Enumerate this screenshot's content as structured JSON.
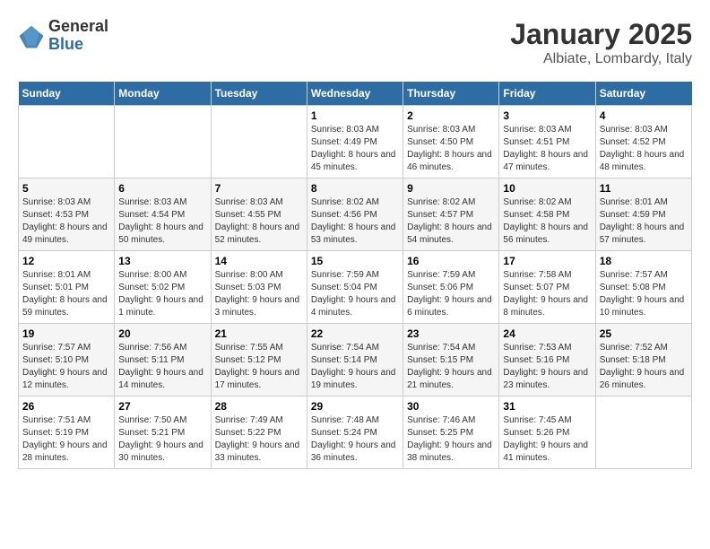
{
  "logo": {
    "general": "General",
    "blue": "Blue"
  },
  "title": "January 2025",
  "location": "Albiate, Lombardy, Italy",
  "weekdays": [
    "Sunday",
    "Monday",
    "Tuesday",
    "Wednesday",
    "Thursday",
    "Friday",
    "Saturday"
  ],
  "weeks": [
    [
      {
        "day": "",
        "sunrise": "",
        "sunset": "",
        "daylight": ""
      },
      {
        "day": "",
        "sunrise": "",
        "sunset": "",
        "daylight": ""
      },
      {
        "day": "",
        "sunrise": "",
        "sunset": "",
        "daylight": ""
      },
      {
        "day": "1",
        "sunrise": "8:03 AM",
        "sunset": "4:49 PM",
        "daylight": "8 hours and 45 minutes."
      },
      {
        "day": "2",
        "sunrise": "8:03 AM",
        "sunset": "4:50 PM",
        "daylight": "8 hours and 46 minutes."
      },
      {
        "day": "3",
        "sunrise": "8:03 AM",
        "sunset": "4:51 PM",
        "daylight": "8 hours and 47 minutes."
      },
      {
        "day": "4",
        "sunrise": "8:03 AM",
        "sunset": "4:52 PM",
        "daylight": "8 hours and 48 minutes."
      }
    ],
    [
      {
        "day": "5",
        "sunrise": "8:03 AM",
        "sunset": "4:53 PM",
        "daylight": "8 hours and 49 minutes."
      },
      {
        "day": "6",
        "sunrise": "8:03 AM",
        "sunset": "4:54 PM",
        "daylight": "8 hours and 50 minutes."
      },
      {
        "day": "7",
        "sunrise": "8:03 AM",
        "sunset": "4:55 PM",
        "daylight": "8 hours and 52 minutes."
      },
      {
        "day": "8",
        "sunrise": "8:02 AM",
        "sunset": "4:56 PM",
        "daylight": "8 hours and 53 minutes."
      },
      {
        "day": "9",
        "sunrise": "8:02 AM",
        "sunset": "4:57 PM",
        "daylight": "8 hours and 54 minutes."
      },
      {
        "day": "10",
        "sunrise": "8:02 AM",
        "sunset": "4:58 PM",
        "daylight": "8 hours and 56 minutes."
      },
      {
        "day": "11",
        "sunrise": "8:01 AM",
        "sunset": "4:59 PM",
        "daylight": "8 hours and 57 minutes."
      }
    ],
    [
      {
        "day": "12",
        "sunrise": "8:01 AM",
        "sunset": "5:01 PM",
        "daylight": "8 hours and 59 minutes."
      },
      {
        "day": "13",
        "sunrise": "8:00 AM",
        "sunset": "5:02 PM",
        "daylight": "9 hours and 1 minute."
      },
      {
        "day": "14",
        "sunrise": "8:00 AM",
        "sunset": "5:03 PM",
        "daylight": "9 hours and 3 minutes."
      },
      {
        "day": "15",
        "sunrise": "7:59 AM",
        "sunset": "5:04 PM",
        "daylight": "9 hours and 4 minutes."
      },
      {
        "day": "16",
        "sunrise": "7:59 AM",
        "sunset": "5:06 PM",
        "daylight": "9 hours and 6 minutes."
      },
      {
        "day": "17",
        "sunrise": "7:58 AM",
        "sunset": "5:07 PM",
        "daylight": "9 hours and 8 minutes."
      },
      {
        "day": "18",
        "sunrise": "7:57 AM",
        "sunset": "5:08 PM",
        "daylight": "9 hours and 10 minutes."
      }
    ],
    [
      {
        "day": "19",
        "sunrise": "7:57 AM",
        "sunset": "5:10 PM",
        "daylight": "9 hours and 12 minutes."
      },
      {
        "day": "20",
        "sunrise": "7:56 AM",
        "sunset": "5:11 PM",
        "daylight": "9 hours and 14 minutes."
      },
      {
        "day": "21",
        "sunrise": "7:55 AM",
        "sunset": "5:12 PM",
        "daylight": "9 hours and 17 minutes."
      },
      {
        "day": "22",
        "sunrise": "7:54 AM",
        "sunset": "5:14 PM",
        "daylight": "9 hours and 19 minutes."
      },
      {
        "day": "23",
        "sunrise": "7:54 AM",
        "sunset": "5:15 PM",
        "daylight": "9 hours and 21 minutes."
      },
      {
        "day": "24",
        "sunrise": "7:53 AM",
        "sunset": "5:16 PM",
        "daylight": "9 hours and 23 minutes."
      },
      {
        "day": "25",
        "sunrise": "7:52 AM",
        "sunset": "5:18 PM",
        "daylight": "9 hours and 26 minutes."
      }
    ],
    [
      {
        "day": "26",
        "sunrise": "7:51 AM",
        "sunset": "5:19 PM",
        "daylight": "9 hours and 28 minutes."
      },
      {
        "day": "27",
        "sunrise": "7:50 AM",
        "sunset": "5:21 PM",
        "daylight": "9 hours and 30 minutes."
      },
      {
        "day": "28",
        "sunrise": "7:49 AM",
        "sunset": "5:22 PM",
        "daylight": "9 hours and 33 minutes."
      },
      {
        "day": "29",
        "sunrise": "7:48 AM",
        "sunset": "5:24 PM",
        "daylight": "9 hours and 36 minutes."
      },
      {
        "day": "30",
        "sunrise": "7:46 AM",
        "sunset": "5:25 PM",
        "daylight": "9 hours and 38 minutes."
      },
      {
        "day": "31",
        "sunrise": "7:45 AM",
        "sunset": "5:26 PM",
        "daylight": "9 hours and 41 minutes."
      },
      {
        "day": "",
        "sunrise": "",
        "sunset": "",
        "daylight": ""
      }
    ]
  ]
}
